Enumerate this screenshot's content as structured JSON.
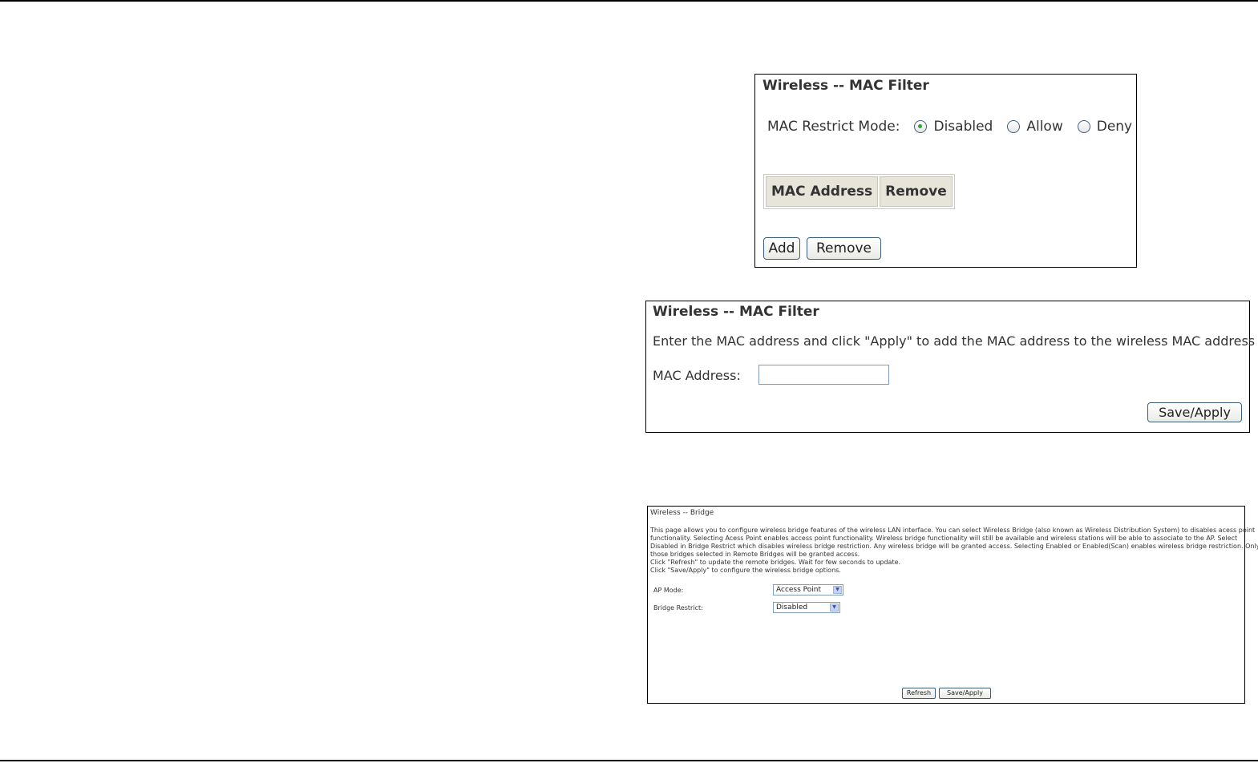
{
  "mac_filter_list": {
    "title": "Wireless -- MAC Filter",
    "restrict_mode_label": "MAC Restrict Mode:",
    "modes": [
      {
        "label": "Disabled",
        "checked": true
      },
      {
        "label": "Allow",
        "checked": false
      },
      {
        "label": "Deny",
        "checked": false
      }
    ],
    "table_headers": [
      "MAC Address",
      "Remove"
    ],
    "add_label": "Add",
    "remove_label": "Remove"
  },
  "mac_filter_add": {
    "title": "Wireless -- MAC Filter",
    "description": "Enter the MAC address and click \"Apply\" to add the MAC address to the wireless MAC address filters.",
    "mac_label": "MAC Address:",
    "mac_value": "",
    "save_label": "Save/Apply"
  },
  "bridge": {
    "title": "Wireless -- Bridge",
    "description_lines": [
      "This page allows you to configure wireless bridge features of the wireless LAN interface. You can select Wireless Bridge (also known as Wireless Distribution System) to disables acess point",
      "functionality. Selecting Acess Point enables access point functionality. Wireless bridge functionality will still be available and wireless stations will be able to associate to the AP. Select",
      "Disabled in Bridge Restrict which disables wireless bridge restriction. Any wireless bridge will be granted access. Selecting Enabled or Enabled(Scan) enables wireless bridge restriction. Only",
      "those bridges selected in Remote Bridges will be granted access.",
      "Click \"Refresh\" to update the remote bridges. Wait for few seconds to update.",
      "Click \"Save/Apply\" to configure the wireless bridge options."
    ],
    "ap_mode_label": "AP Mode:",
    "ap_mode_value": "Access Point",
    "bridge_restrict_label": "Bridge Restrict:",
    "bridge_restrict_value": "Disabled",
    "refresh_label": "Refresh",
    "save_label": "Save/Apply"
  },
  "icons": {
    "radio_checked_color": "#2ea82e",
    "dropdown_arrow": "chevron-down-icon"
  }
}
